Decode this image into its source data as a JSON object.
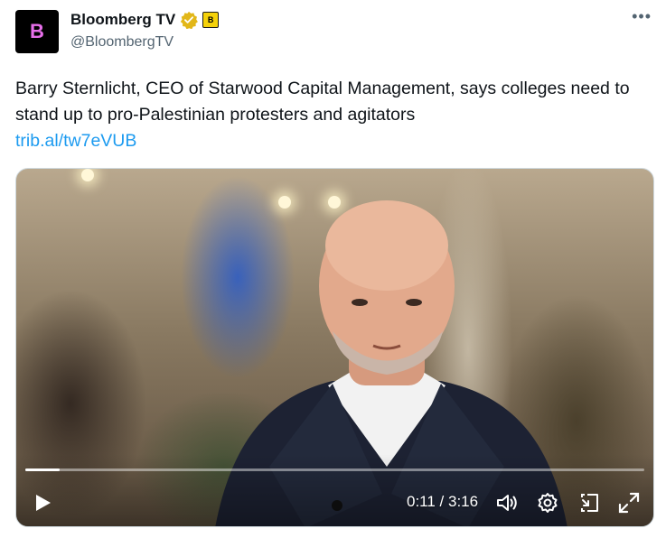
{
  "account": {
    "avatar_letter": "B",
    "display_name": "Bloomberg TV",
    "handle": "@BloombergTV",
    "affiliate_badge_letter": "B",
    "verified_icon": "verified-gold-badge-icon"
  },
  "menu": {
    "more_label": "•••"
  },
  "tweet": {
    "text": "Barry Sternlicht, CEO of Starwood Capital Management, says colleges need to stand up to pro-Palestinian protesters and agitators",
    "link": "trib.al/tw7eVUB"
  },
  "video": {
    "current_time": "0:11",
    "duration": "3:16",
    "time_display": "0:11 / 3:16",
    "progress": 0.056,
    "controls": [
      "play-icon",
      "volume-icon",
      "settings-gear-icon",
      "picture-in-picture-icon",
      "fullscreen-icon"
    ]
  },
  "colors": {
    "text": "#0f1419",
    "secondary": "#536471",
    "link": "#1d9bf0",
    "verified_gold": "#e2b719",
    "avatar_accent": "#e76fea"
  }
}
